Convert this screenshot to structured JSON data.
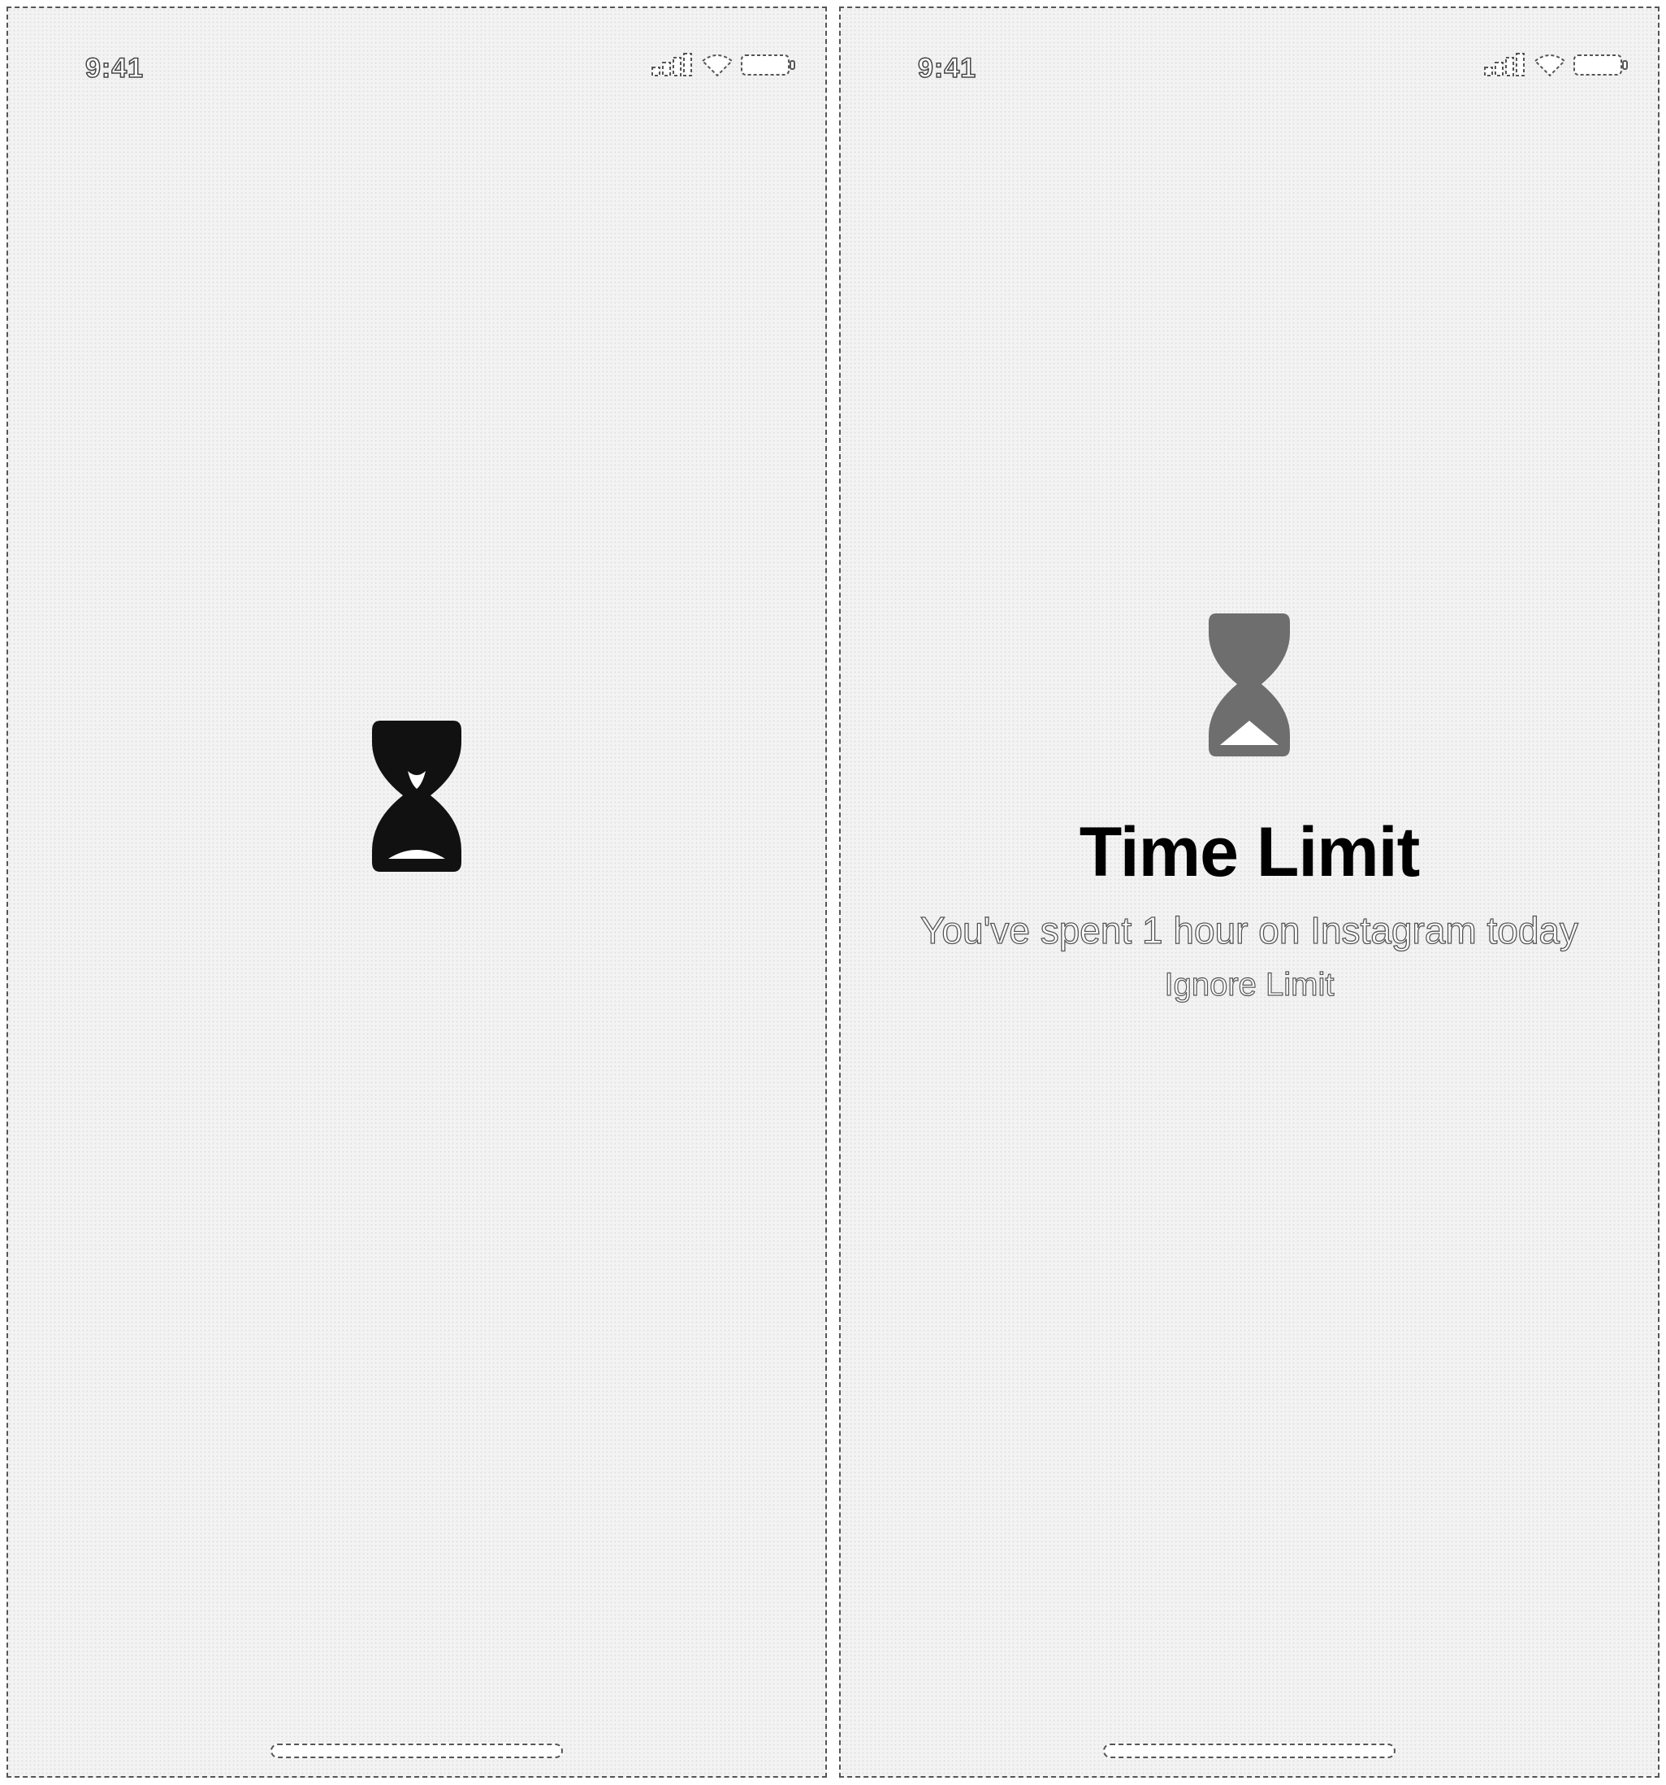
{
  "left_screen": {
    "status_bar": {
      "time": "9:41",
      "icons": [
        "signal-icon",
        "wifi-icon",
        "battery-icon"
      ]
    },
    "hourglass_icon": "hourglass-icon",
    "hourglass_color": "#111111"
  },
  "right_screen": {
    "status_bar": {
      "time": "9:41",
      "icons": [
        "signal-icon",
        "wifi-icon",
        "battery-icon"
      ]
    },
    "hourglass_icon": "hourglass-icon",
    "hourglass_color": "#6e6e6e",
    "title": "Time Limit",
    "subtitle": "You've spent 1 hour on Instagram today",
    "ignore_label": "Ignore Limit"
  }
}
